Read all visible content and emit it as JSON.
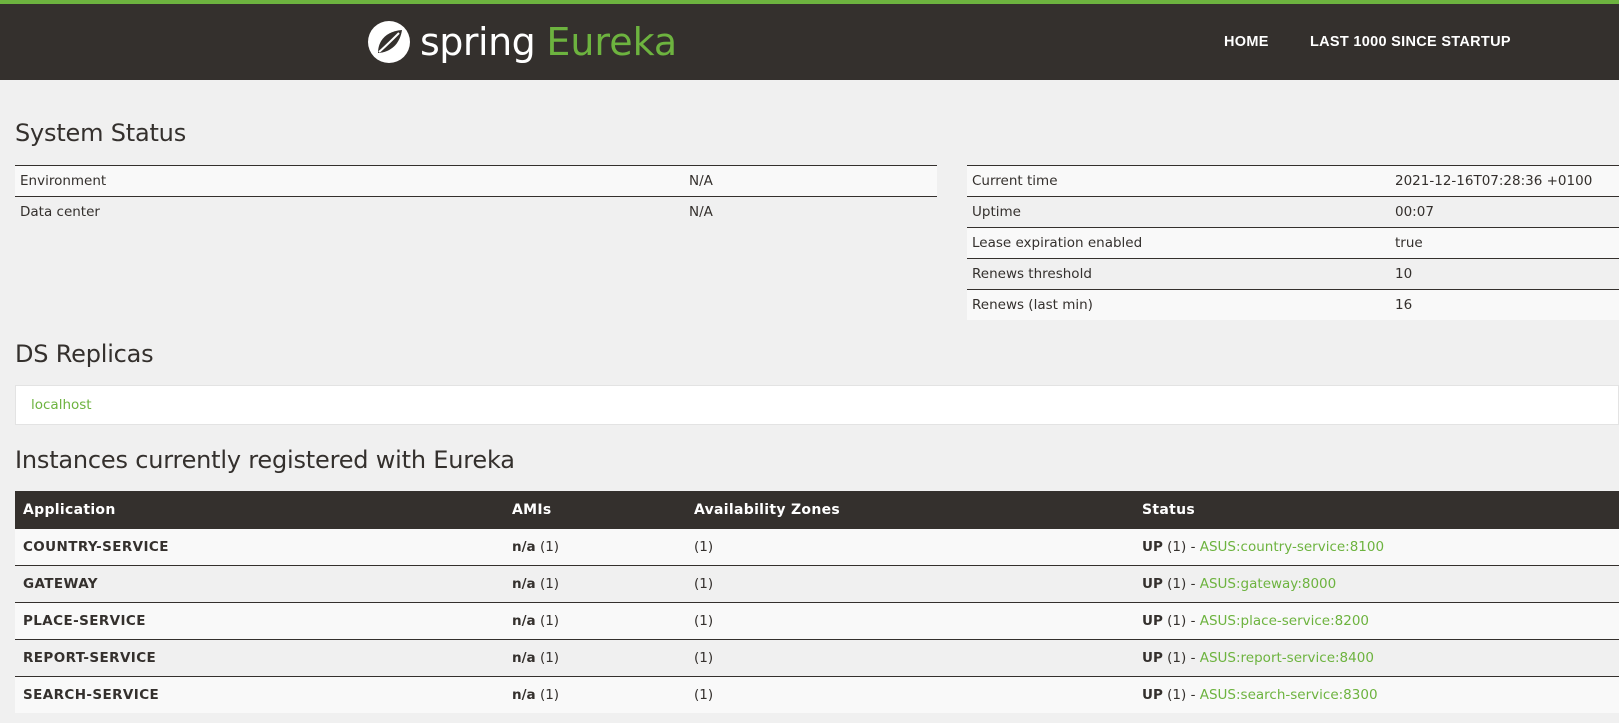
{
  "header": {
    "brand_word": "spring",
    "brand_product": "Eureka",
    "nav": [
      {
        "label": "HOME"
      },
      {
        "label": "LAST 1000 SINCE STARTUP"
      }
    ]
  },
  "system_status": {
    "title": "System Status",
    "left": [
      {
        "key": "Environment",
        "value": "N/A"
      },
      {
        "key": "Data center",
        "value": "N/A"
      }
    ],
    "right": [
      {
        "key": "Current time",
        "value": "2021-12-16T07:28:36 +0100"
      },
      {
        "key": "Uptime",
        "value": "00:07"
      },
      {
        "key": "Lease expiration enabled",
        "value": "true"
      },
      {
        "key": "Renews threshold",
        "value": "10"
      },
      {
        "key": "Renews (last min)",
        "value": "16"
      }
    ]
  },
  "ds_replicas": {
    "title": "DS Replicas",
    "items": [
      "localhost"
    ]
  },
  "instances": {
    "title": "Instances currently registered with Eureka",
    "columns": [
      "Application",
      "AMIs",
      "Availability Zones",
      "Status"
    ],
    "rows": [
      {
        "app": "COUNTRY-SERVICE",
        "ami": "n/a",
        "ami_count": "(1)",
        "zones": "(1)",
        "status": "UP",
        "status_count": "(1) -",
        "instance": "ASUS:country-service:8100"
      },
      {
        "app": "GATEWAY",
        "ami": "n/a",
        "ami_count": "(1)",
        "zones": "(1)",
        "status": "UP",
        "status_count": "(1) -",
        "instance": "ASUS:gateway:8000"
      },
      {
        "app": "PLACE-SERVICE",
        "ami": "n/a",
        "ami_count": "(1)",
        "zones": "(1)",
        "status": "UP",
        "status_count": "(1) -",
        "instance": "ASUS:place-service:8200"
      },
      {
        "app": "REPORT-SERVICE",
        "ami": "n/a",
        "ami_count": "(1)",
        "zones": "(1)",
        "status": "UP",
        "status_count": "(1) -",
        "instance": "ASUS:report-service:8400"
      },
      {
        "app": "SEARCH-SERVICE",
        "ami": "n/a",
        "ami_count": "(1)",
        "zones": "(1)",
        "status": "UP",
        "status_count": "(1) -",
        "instance": "ASUS:search-service:8300"
      }
    ]
  },
  "colors": {
    "brand_green": "#6db33f",
    "header_bg": "#34302d"
  }
}
